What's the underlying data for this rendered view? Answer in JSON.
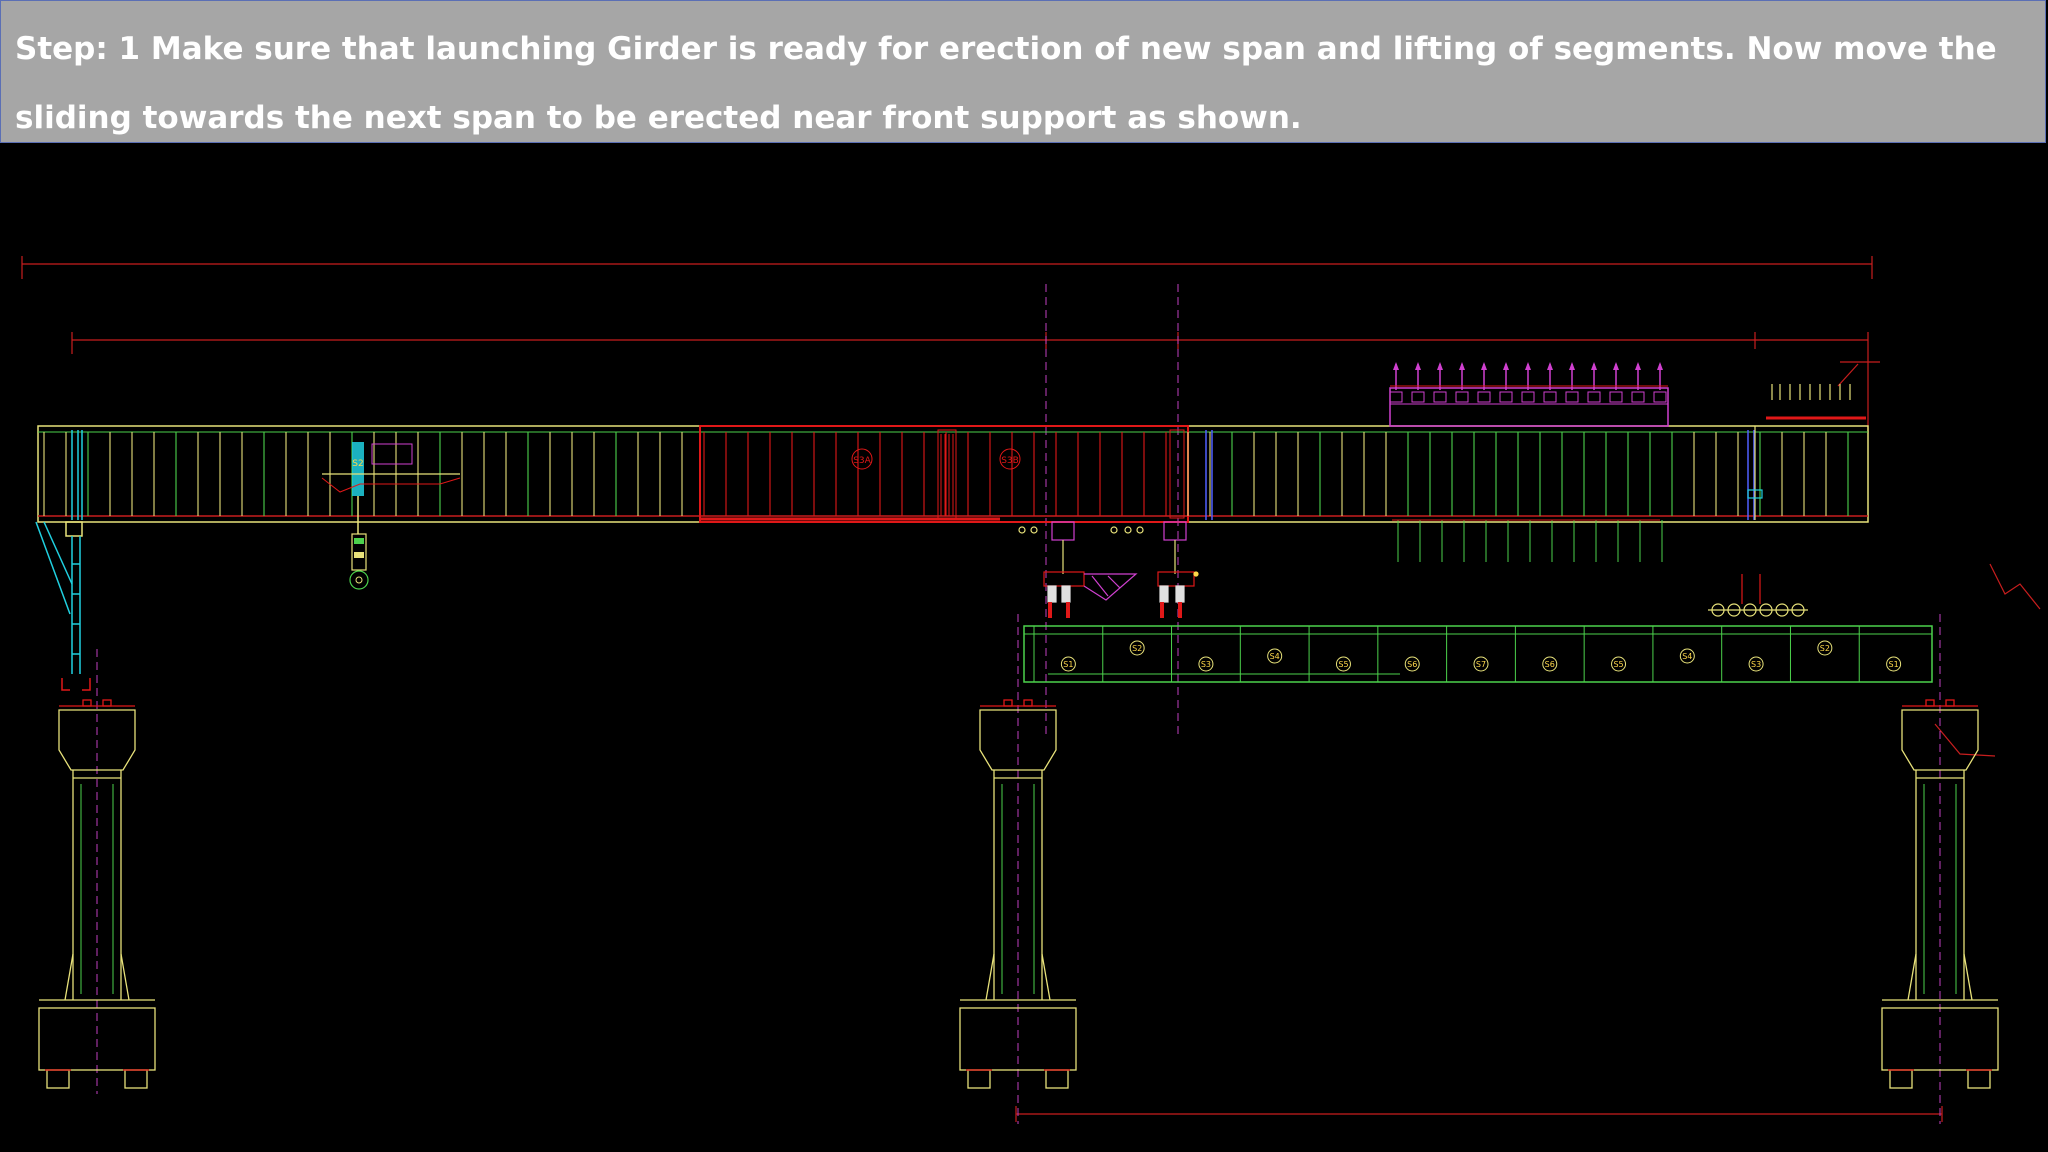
{
  "slide": {
    "step_text": "Step: 1 Make sure that launching Girder is ready for erection of new span and lifting of segments. Now move the sliding towards the next span to be erected near front support as shown."
  },
  "drawing": {
    "girder_tags": [
      "S3A",
      "S3B"
    ],
    "crane_tag": "S2",
    "segments": [
      "S1",
      "S2",
      "S3",
      "S4",
      "S5",
      "S6",
      "S7",
      "S6",
      "S5",
      "S4",
      "S3",
      "S2",
      "S1"
    ],
    "colors": {
      "background": "#000000",
      "banner": "#a6a6a6",
      "dimension": "#c81e1e",
      "structure_yellow": "#e8e27a",
      "structure_green": "#4cd24c",
      "structure_red": "#e01818",
      "accent_magenta": "#d040d0",
      "accent_cyan": "#20d0e0",
      "centerline": "#c040c0"
    }
  }
}
